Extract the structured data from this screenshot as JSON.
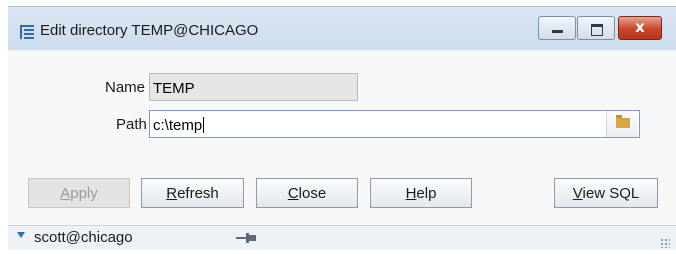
{
  "window": {
    "title": "Edit directory TEMP@CHICAGO",
    "icon": "list-icon",
    "controls": {
      "minimize": "minimize-icon",
      "maximize": "maximize-icon",
      "close": "x"
    }
  },
  "form": {
    "name_label": "Name",
    "name_value": "TEMP",
    "path_label": "Path",
    "path_value": "c:\\temp",
    "browse_icon": "folder-icon"
  },
  "buttons": {
    "apply": {
      "mnemonic": "A",
      "rest": "pply",
      "enabled": false
    },
    "refresh": {
      "mnemonic": "R",
      "rest": "efresh"
    },
    "close": {
      "mnemonic": "C",
      "rest": "lose"
    },
    "help": {
      "mnemonic": "H",
      "rest": "elp"
    },
    "view_sql": {
      "mnemonic": "V",
      "rest": "iew SQL"
    }
  },
  "statusbar": {
    "connection": "scott@chicago",
    "pin_icon": "pin-icon"
  },
  "colors": {
    "close_button": "#c9452b",
    "titlebar": "#d6e2f0",
    "accent": "#2d6fb7"
  }
}
